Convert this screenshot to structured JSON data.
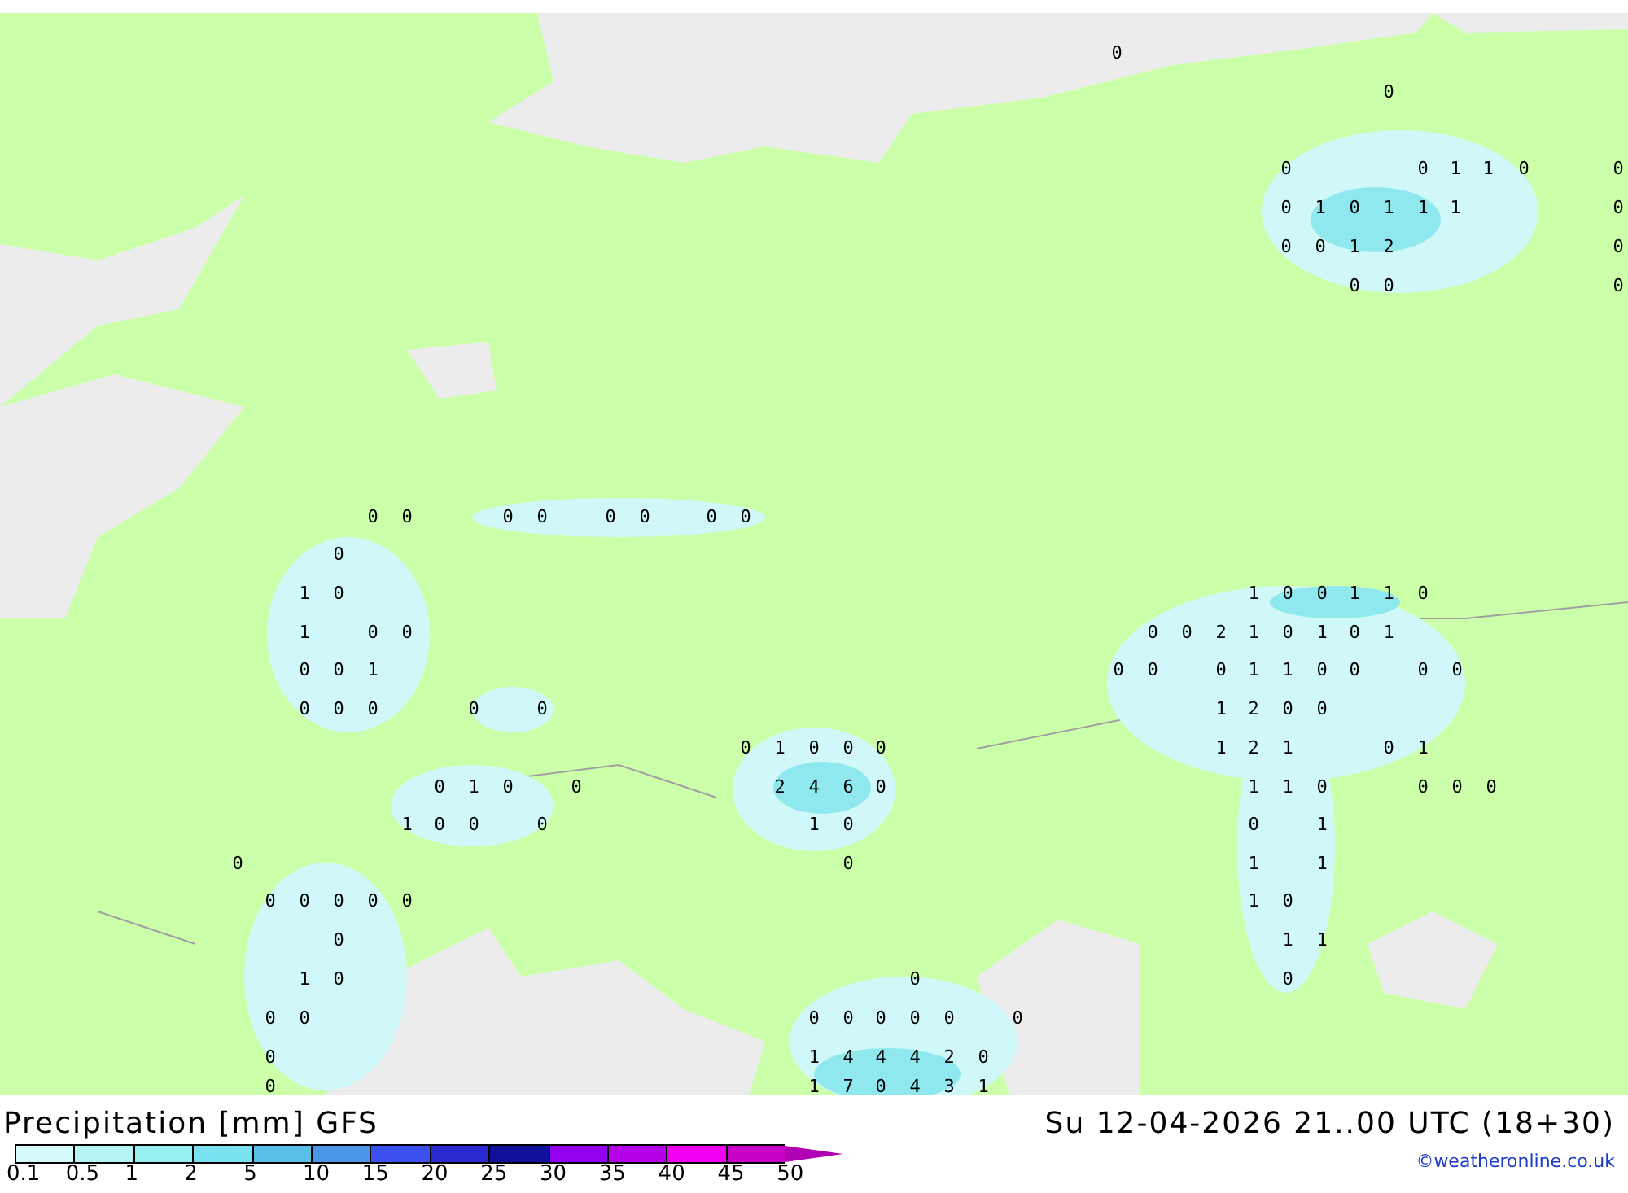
{
  "map_labels": [
    "0",
    "0",
    "0",
    "0",
    "1",
    "1",
    "0",
    "0",
    "0",
    "1",
    "0",
    "1",
    "1",
    "1",
    "0",
    "0",
    "0",
    "1",
    "2",
    "0",
    "0",
    "0",
    "0",
    "0",
    "0",
    "0",
    "0",
    "0",
    "0",
    "0",
    "0",
    "0",
    "1",
    "0",
    "1",
    "0",
    "0",
    "1",
    "1",
    "0",
    "1",
    "0",
    "0",
    "0",
    "0",
    "2",
    "1",
    "0",
    "1",
    "0",
    "1",
    "0",
    "0",
    "1",
    "0",
    "0",
    "0",
    "1",
    "1",
    "0",
    "0",
    "0",
    "0",
    "0",
    "0",
    "0",
    "0",
    "0",
    "1",
    "2",
    "0",
    "0",
    "0",
    "1",
    "0",
    "0",
    "0",
    "1",
    "2",
    "1",
    "0",
    "1",
    "0",
    "1",
    "0",
    "0",
    "2",
    "4",
    "6",
    "0",
    "1",
    "1",
    "0",
    "0",
    "0",
    "0",
    "1",
    "0",
    "0",
    "0",
    "1",
    "0",
    "0",
    "1",
    "0",
    "0",
    "1",
    "1",
    "0",
    "0",
    "0",
    "0",
    "0",
    "1",
    "0",
    "0",
    "1",
    "1",
    "1",
    "0",
    "0",
    "0",
    "0",
    "0",
    "0",
    "0",
    "0",
    "0",
    "0",
    "0",
    "0",
    "1",
    "4",
    "4",
    "4",
    "2",
    "0",
    "0",
    "1",
    "7",
    "0",
    "4",
    "3",
    "1"
  ],
  "title": "Precipitation [mm] GFS",
  "valid_time": "Su 12-04-2026 21..00 UTC (18+30)",
  "legend": [
    {
      "label": "0.1",
      "color": "#d4fafa"
    },
    {
      "label": "0.5",
      "color": "#b4f4f4"
    },
    {
      "label": "1",
      "color": "#96eeee"
    },
    {
      "label": "2",
      "color": "#78e0ee"
    },
    {
      "label": "5",
      "color": "#5ac0ea"
    },
    {
      "label": "10",
      "color": "#4a96e6"
    },
    {
      "label": "15",
      "color": "#3c50f0"
    },
    {
      "label": "20",
      "color": "#2a2ad0"
    },
    {
      "label": "25",
      "color": "#10109c"
    },
    {
      "label": "30",
      "color": "#9600f0"
    },
    {
      "label": "35",
      "color": "#b400e8"
    },
    {
      "label": "40",
      "color": "#f000f0"
    },
    {
      "label": "45",
      "color": "#c800c8"
    },
    {
      "label": "50",
      "color": "#b000b4"
    }
  ],
  "credit": "©weatheronline.co.uk"
}
